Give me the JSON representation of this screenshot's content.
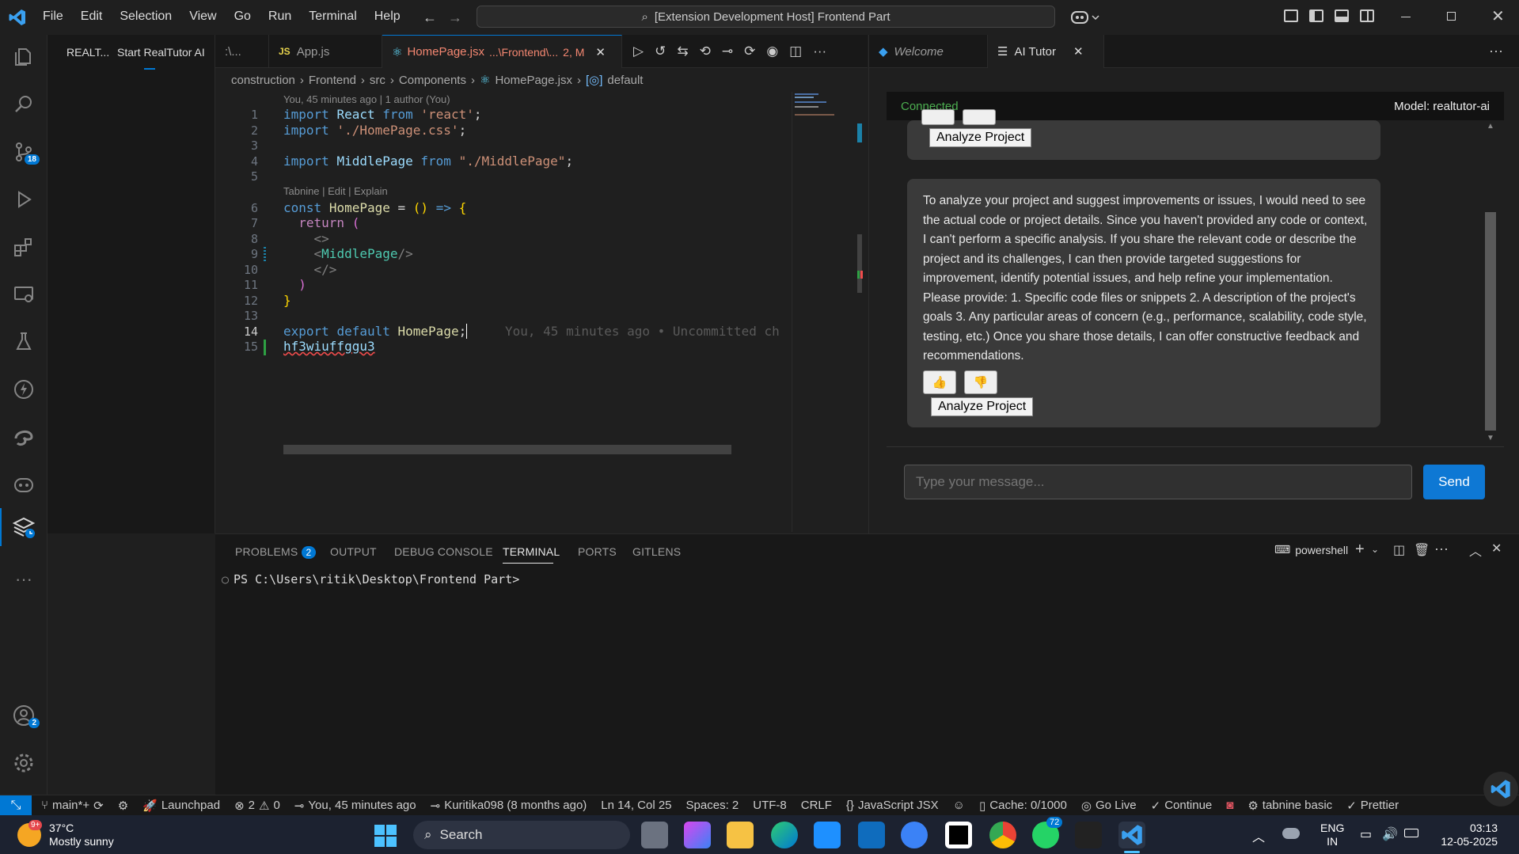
{
  "titlebar": {
    "menus": [
      "File",
      "Edit",
      "Selection",
      "View",
      "Go",
      "Run",
      "Terminal",
      "Help"
    ],
    "command_center": "[Extension Development Host] Frontend Part"
  },
  "activity": {
    "scm_badge": "18",
    "accounts_badge": "2"
  },
  "sidebar": {
    "tabs": [
      "REALT...",
      "Start RealTutor AI"
    ]
  },
  "editor": {
    "tabs": [
      {
        "label": ":\\..."
      },
      {
        "label": "App.js",
        "icon": "JS"
      },
      {
        "label": "HomePage.jsx",
        "detail": "...\\Frontend\\...",
        "status": "2, M"
      }
    ],
    "breadcrumb": [
      "construction",
      "Frontend",
      "src",
      "Components",
      "HomePage.jsx",
      "default"
    ],
    "blame_header": "You, 45 minutes ago | 1 author (You)",
    "codelens": "Tabnine | Edit | Explain",
    "inline_blame": "You, 45 minutes ago • Uncommitted ch",
    "line_numbers": [
      "1",
      "2",
      "3",
      "4",
      "5",
      "6",
      "7",
      "8",
      "9",
      "10",
      "11",
      "12",
      "13",
      "14",
      "15"
    ]
  },
  "right": {
    "tabs": [
      {
        "label": "Welcome"
      },
      {
        "label": "AI Tutor"
      }
    ],
    "status": "Connected",
    "model": "Model: realtutor-ai",
    "message": "To analyze your project and suggest improvements or issues, I would need to see the actual code or project details. Since you haven't provided any code or context, I can't perform a specific analysis. If you share the relevant code or describe the project and its challenges, I can then provide targeted suggestions for improvement, identify potential issues, and help refine your implementation. Please provide: 1. Specific code files or snippets 2. A description of the project's goals 3. Any particular areas of concern (e.g., performance, scalability, code style, testing, etc.) Once you share those details, I can offer constructive feedback and recommendations.",
    "analyze_label": "Analyze Project",
    "thumb_up": "👍",
    "thumb_down": "👎",
    "input_placeholder": "Type your message...",
    "send_label": "Send"
  },
  "panel": {
    "tabs": [
      "PROBLEMS",
      "OUTPUT",
      "DEBUG CONSOLE",
      "TERMINAL",
      "PORTS",
      "GITLENS"
    ],
    "problems_count": "2",
    "shell": "powershell",
    "prompt": "PS C:\\Users\\ritik\\Desktop\\Frontend Part>"
  },
  "status": {
    "branch": "main*+",
    "launchpad": "Launchpad",
    "errors": "2",
    "warnings": "0",
    "blame": "You, 45 minutes ago",
    "author": "Kuritika098 (8 months ago)",
    "position": "Ln 14, Col 25",
    "spaces": "Spaces: 2",
    "encoding": "UTF-8",
    "eol": "CRLF",
    "language": "JavaScript JSX",
    "cache": "Cache: 0/1000",
    "golive": "Go Live",
    "continue": "Continue",
    "tabnine": "tabnine basic",
    "prettier": "Prettier"
  },
  "taskbar": {
    "weather_temp": "37°C",
    "weather_desc": "Mostly sunny",
    "weather_badge": "9+",
    "search": "Search",
    "lang1": "ENG",
    "lang2": "IN",
    "time": "03:13",
    "date": "12-05-2025",
    "whatsapp_badge": "72"
  },
  "colors": {
    "accent": "#0078d4",
    "modified_tab": "#f48771",
    "keyword": "#569cd6",
    "string": "#ce9178"
  }
}
